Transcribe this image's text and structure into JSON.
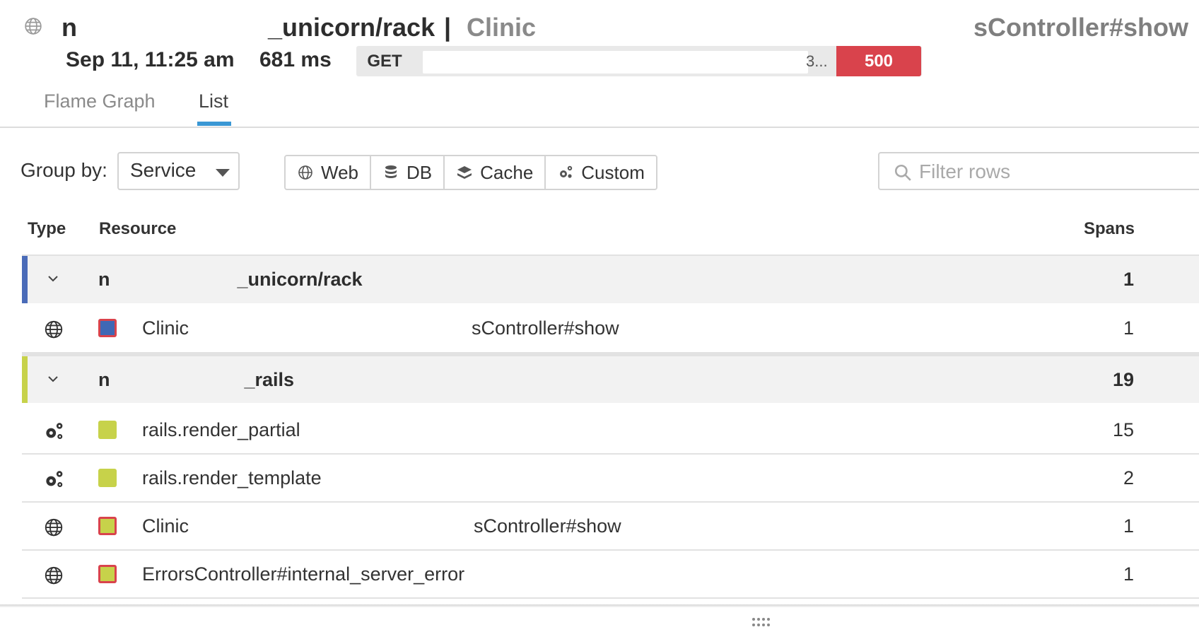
{
  "header": {
    "service_prefix": "n",
    "service_suffix": "_unicorn/rack",
    "separator": "|",
    "resource_prefix": "Clinic",
    "resource_right": "sController#show",
    "date": "Sep 11, 11:25 am",
    "duration": "681 ms",
    "method": "GET",
    "url_tail": "3...",
    "status": "500"
  },
  "tabs": [
    {
      "label": "Flame Graph",
      "active": false
    },
    {
      "label": "List",
      "active": true
    }
  ],
  "toolbar": {
    "group_by_label": "Group by:",
    "group_by_value": "Service",
    "type_filters": [
      {
        "label": "Web",
        "icon": "globe-icon"
      },
      {
        "label": "DB",
        "icon": "database-icon"
      },
      {
        "label": "Cache",
        "icon": "layers-icon"
      },
      {
        "label": "Custom",
        "icon": "gears-icon"
      }
    ],
    "filter_placeholder": "Filter rows"
  },
  "table": {
    "headers": {
      "type": "Type",
      "resource": "Resource",
      "spans": "Spans"
    },
    "groups": [
      {
        "name_prefix": "n",
        "name_suffix": "_unicorn/rack",
        "spans": "1",
        "stripe_color": "#4a6bb8",
        "items": [
          {
            "icon": "globe-icon",
            "swatch_color": "#3f68b5",
            "swatch_border": "#d9434c",
            "name_prefix": "Clinic",
            "name_suffix": "sController#show",
            "spans": "1"
          }
        ]
      },
      {
        "name_prefix": "n",
        "name_suffix": "_rails",
        "spans": "19",
        "stripe_color": "#c7d24a",
        "items": [
          {
            "icon": "gears-icon",
            "swatch_color": "#c7d24a",
            "swatch_border": "#c7d24a",
            "name_prefix": "rails.render_partial",
            "name_suffix": "",
            "spans": "15"
          },
          {
            "icon": "gears-icon",
            "swatch_color": "#c7d24a",
            "swatch_border": "#c7d24a",
            "name_prefix": "rails.render_template",
            "name_suffix": "",
            "spans": "2"
          },
          {
            "icon": "globe-icon",
            "swatch_color": "#c7d24a",
            "swatch_border": "#d9434c",
            "name_prefix": "Clinic",
            "name_suffix": "sController#show",
            "spans": "1"
          },
          {
            "icon": "globe-icon",
            "swatch_color": "#c7d24a",
            "swatch_border": "#d9434c",
            "name_prefix": "ErrorsController#internal_server_error",
            "name_suffix": "",
            "spans": "1"
          }
        ]
      }
    ]
  }
}
